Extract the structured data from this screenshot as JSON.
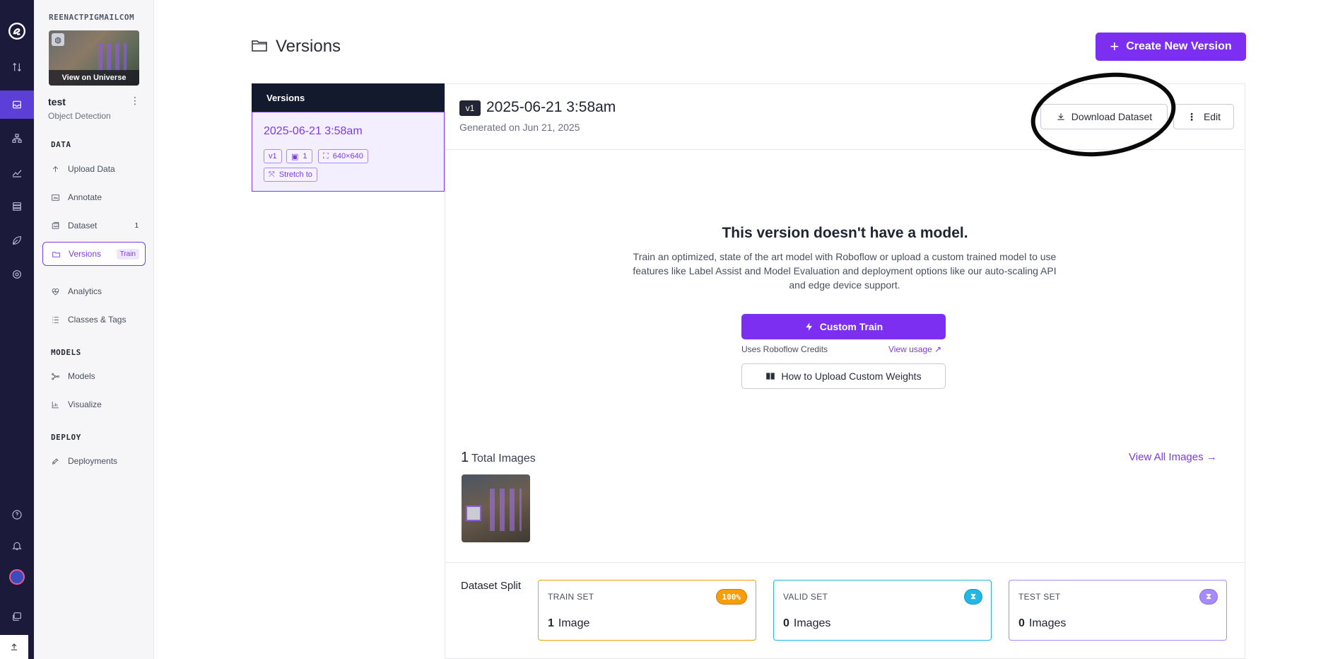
{
  "rail": {
    "icons": [
      "roboflow-logo-icon",
      "sync-icon",
      "inbox-icon",
      "workflows-icon",
      "monitoring-icon",
      "database-icon",
      "leaf-icon",
      "settings-icon",
      "help-icon",
      "notifications-icon",
      "user-avatar-icon",
      "stack-icon",
      "upload-icon"
    ]
  },
  "sidebar": {
    "workspace": "REENACTPIGMAILCOM",
    "view_on_universe": "View on Universe",
    "project_name": "test",
    "project_type": "Object Detection",
    "sections": {
      "data": "DATA",
      "models": "MODELS",
      "deploy": "DEPLOY"
    },
    "data_items": [
      {
        "label": "Upload Data",
        "icon": "upload-icon"
      },
      {
        "label": "Annotate",
        "icon": "annotate-icon"
      },
      {
        "label": "Dataset",
        "icon": "image-stack-icon",
        "count": "1"
      },
      {
        "label": "Versions",
        "icon": "folder-icon",
        "pill": "Train"
      },
      {
        "label": "Analytics",
        "icon": "heart-pulse-icon"
      },
      {
        "label": "Classes & Tags",
        "icon": "list-icon"
      }
    ],
    "model_items": [
      {
        "label": "Models",
        "icon": "network-icon"
      },
      {
        "label": "Visualize",
        "icon": "chart-icon"
      }
    ],
    "deploy_items": [
      {
        "label": "Deployments",
        "icon": "rocket-icon"
      }
    ]
  },
  "header": {
    "title": "Versions",
    "create_button": "Create New Version"
  },
  "versions_list": {
    "header": "Versions",
    "items": [
      {
        "date": "2025-06-21 3:58am",
        "version_chip": "v1",
        "images_chip": "1",
        "size_chip": "640×640",
        "preprocess_chip": "Stretch to"
      }
    ]
  },
  "detail": {
    "version_badge": "v1",
    "title": "2025-06-21 3:58am",
    "generated": "Generated on Jun 21, 2025",
    "download_button": "Download Dataset",
    "edit_button": "Edit",
    "no_model_title": "This version doesn't have a model.",
    "no_model_desc": "Train an optimized, state of the art model with Roboflow or upload a custom trained model to use features like Label Assist and Model Evaluation and deployment options like our auto-scaling API and edge device support.",
    "custom_train_button": "Custom Train",
    "credits_note": "Uses Roboflow Credits",
    "view_usage": "View usage ↗",
    "upload_weights_button": "How to Upload Custom Weights",
    "total_images_count": "1",
    "total_images_label": "Total Images",
    "view_all_images": "View All Images →",
    "dataset_split_label": "Dataset Split",
    "splits": [
      {
        "name": "TRAIN SET",
        "count": "1",
        "unit": "Image",
        "pill": "100%",
        "color": "#f59e0b"
      },
      {
        "name": "VALID SET",
        "count": "0",
        "unit": "Images",
        "pill": "⧗",
        "color": "#22b8e6"
      },
      {
        "name": "TEST SET",
        "count": "0",
        "unit": "Images",
        "pill": "⧗",
        "color": "#a78bfa"
      }
    ]
  },
  "colors": {
    "accent": "#7c2ff0",
    "rail_bg": "#1c1a3a",
    "versions_header_bg": "#141a2e"
  }
}
